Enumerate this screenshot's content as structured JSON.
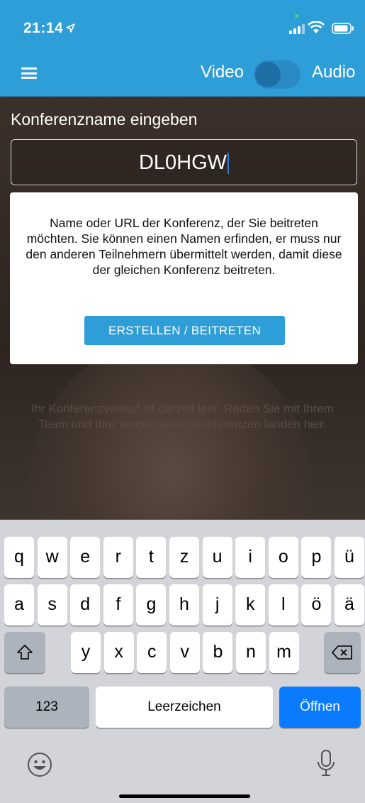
{
  "status_bar": {
    "time": "21:14"
  },
  "nav": {
    "video_label": "Video",
    "audio_label": "Audio"
  },
  "conference": {
    "label": "Konferenzname eingeben",
    "input_value": "DL0HGW",
    "info_text": "Name oder URL der Konferenz, der Sie beitreten möchten. Sie können einen Namen erfinden, er muss nur den anderen Teilnehmern übermittelt werden, damit diese der gleichen Konferenz beitreten.",
    "button_label": "ERSTELLEN / BEITRETEN",
    "history_text": "Ihr Konferenzverlauf ist derzeit leer. Reden Sie mit Ihrem Team und Ihre vergangenen Konferenzen landen hier."
  },
  "keyboard": {
    "row1": [
      "q",
      "w",
      "e",
      "r",
      "t",
      "z",
      "u",
      "i",
      "o",
      "p",
      "ü"
    ],
    "row2": [
      "a",
      "s",
      "d",
      "f",
      "g",
      "h",
      "j",
      "k",
      "l",
      "ö",
      "ä"
    ],
    "row3": [
      "y",
      "x",
      "c",
      "v",
      "b",
      "n",
      "m"
    ],
    "numbers_key": "123",
    "space_key": "Leerzeichen",
    "return_key": "Öffnen"
  },
  "icons": {
    "menu": "hamburger-menu-icon",
    "location": "location-arrow-icon",
    "signal": "cellular-signal-icon",
    "wifi": "wifi-icon",
    "battery": "battery-icon",
    "shift": "shift-icon",
    "backspace": "backspace-icon",
    "emoji": "emoji-icon",
    "dictation": "microphone-icon"
  },
  "colors": {
    "accent": "#2e9ed8",
    "return_key": "#0a7aff",
    "keyboard_bg": "#d2d4d9"
  }
}
